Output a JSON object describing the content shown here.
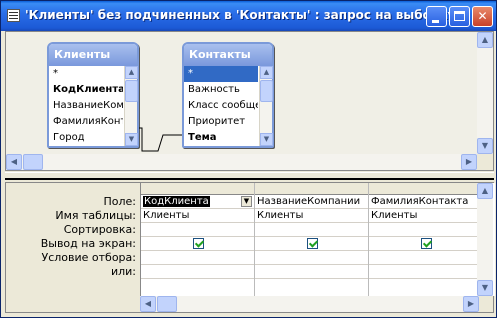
{
  "window": {
    "title": "'Клиенты' без подчиненных в 'Контакты' : запрос на выборку",
    "minimize_icon": "minimize-icon",
    "maximize_icon": "maximize-icon",
    "close_icon": "close-icon"
  },
  "tables": [
    {
      "name": "Клиенты",
      "fields": [
        "*",
        "КодКлиента",
        "НазваниеКомпании",
        "ФамилияКонтакта",
        "Город"
      ],
      "bold": [
        false,
        true,
        false,
        false,
        false
      ],
      "selected_index": -1
    },
    {
      "name": "Контакты",
      "fields": [
        "*",
        "Важность",
        "Класс сообщения",
        "Приоритет",
        "Тема"
      ],
      "bold": [
        false,
        false,
        false,
        false,
        true
      ],
      "selected_index": 0
    }
  ],
  "grid": {
    "row_labels": [
      "Поле:",
      "Имя таблицы:",
      "Сортировка:",
      "Вывод на экран:",
      "Условие отбора:",
      "или:"
    ],
    "columns": [
      {
        "field": "КодКлиента",
        "table": "Клиенты",
        "sort": "",
        "show": true,
        "criteria": "",
        "or": ""
      },
      {
        "field": "НазваниеКомпании",
        "table": "Клиенты",
        "sort": "",
        "show": true,
        "criteria": "",
        "or": ""
      },
      {
        "field": "ФамилияКонтакта",
        "table": "Клиенты",
        "sort": "",
        "show": true,
        "criteria": "",
        "or": ""
      }
    ]
  },
  "colors": {
    "titlebar": "#2a6ee8",
    "fieldlist_header": "#7a98dc",
    "selection": "#316ac5",
    "window_bg": "#ece9d8"
  }
}
